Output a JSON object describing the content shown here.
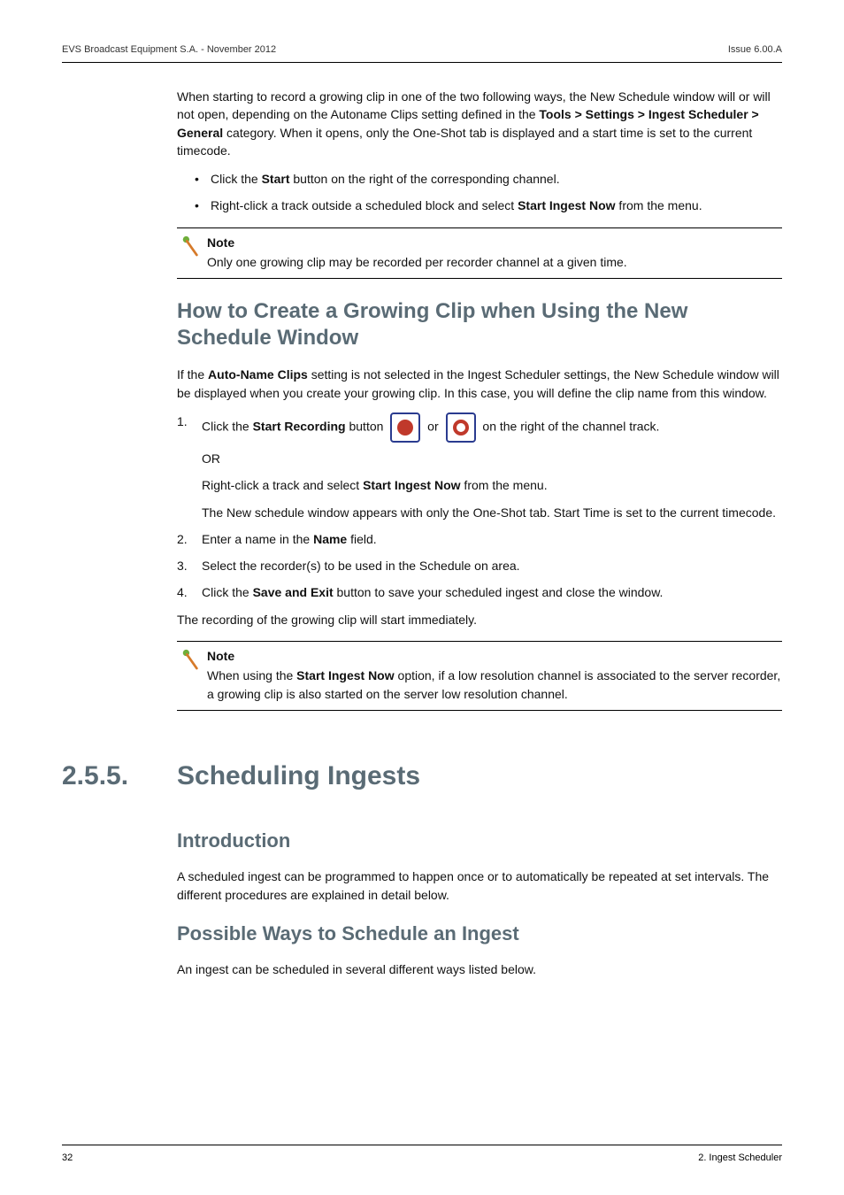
{
  "header": {
    "left": "EVS Broadcast Equipment S.A. - November 2012",
    "right": "Issue 6.00.A"
  },
  "intro": {
    "para1_a": "When starting to record a growing clip in one of the two following ways, the New Schedule window will or will not open, depending on the Autoname Clips setting defined in the ",
    "para1_b": "Tools > Settings > Ingest Scheduler > General",
    "para1_c": " category. When it opens, only the One-Shot tab is displayed and a start time is set to the current timecode.",
    "bullet1_a": "Click the ",
    "bullet1_b": "Start",
    "bullet1_c": " button on the right of the corresponding channel.",
    "bullet2_a": "Right-click a track outside a scheduled block and select ",
    "bullet2_b": "Start Ingest Now",
    "bullet2_c": " from the menu."
  },
  "note1": {
    "head": "Note",
    "body": "Only one growing clip may be recorded per recorder channel at a given time."
  },
  "howto": {
    "heading": "How to Create a Growing Clip when Using the New Schedule Window",
    "para_a": "If the ",
    "para_b": "Auto-Name Clips",
    "para_c": " setting is not selected in the Ingest Scheduler settings, the New Schedule window will be displayed when you create your growing clip. In this case, you will define the clip name from this window.",
    "step1_a": "Click the ",
    "step1_b": "Start Recording",
    "step1_c": " button ",
    "step1_or": " or ",
    "step1_d": " on the right of the channel track.",
    "step1_or2": "OR",
    "step1_e_a": "Right-click a track and select ",
    "step1_e_b": "Start Ingest Now",
    "step1_e_c": " from the menu.",
    "step1_f": "The New schedule window appears with only the One-Shot tab. Start Time is set to the current timecode.",
    "step2_a": "Enter a name in the ",
    "step2_b": "Name",
    "step2_c": " field.",
    "step3": "Select the recorder(s) to be used in the Schedule on area.",
    "step4_a": "Click the ",
    "step4_b": "Save and Exit",
    "step4_c": " button to save your scheduled ingest and close the window.",
    "closing": "The recording of the growing clip will start immediately."
  },
  "note2": {
    "head": "Note",
    "body_a": "When using the ",
    "body_b": "Start Ingest Now",
    "body_c": " option, if a low resolution channel is associated to the server recorder, a growing clip is also started on the server low resolution channel."
  },
  "scheduling": {
    "num": "2.5.5.",
    "title": "Scheduling Ingests",
    "intro_h": "Introduction",
    "intro_p": "A scheduled ingest can be programmed to happen once or to automatically be repeated at set intervals. The different procedures are explained in detail below.",
    "ways_h": "Possible Ways to Schedule an Ingest",
    "ways_p": "An ingest can be scheduled in several different ways listed below."
  },
  "footer": {
    "left": "32",
    "right": "2. Ingest Scheduler"
  }
}
